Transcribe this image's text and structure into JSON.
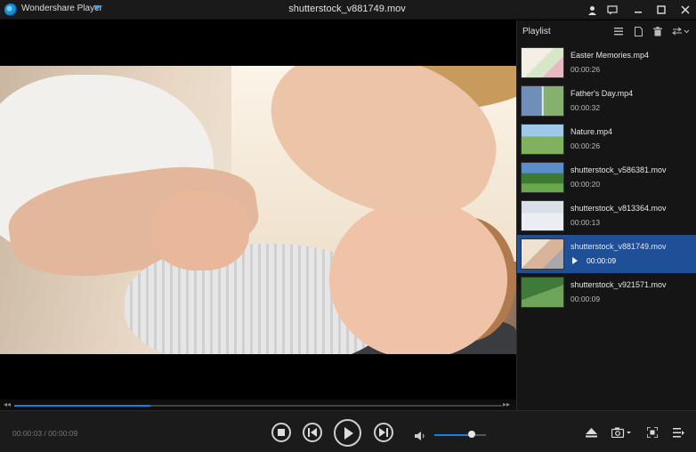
{
  "titlebar": {
    "app_name": "Wondershare Player",
    "file_title": "shutterstock_v881749.mov",
    "icons": [
      "user-icon",
      "feedback-icon",
      "minimize-icon",
      "maximize-icon",
      "close-icon"
    ]
  },
  "video": {
    "progress_fraction": 0.28,
    "seek_back_glyph": "◂◂",
    "seek_fwd_glyph": "▸▸"
  },
  "playlist": {
    "title": "Playlist",
    "tools": [
      "list-view-icon",
      "file-icon",
      "trash-icon",
      "loop-mode-icon"
    ],
    "items": [
      {
        "name": "Easter Memories.mp4",
        "duration": "00:00:26",
        "active": false
      },
      {
        "name": "Father's Day.mp4",
        "duration": "00:00:32",
        "active": false
      },
      {
        "name": "Nature.mp4",
        "duration": "00:00:26",
        "active": false
      },
      {
        "name": "shutterstock_v586381.mov",
        "duration": "00:00:20",
        "active": false
      },
      {
        "name": "shutterstock_v813364.mov",
        "duration": "00:00:13",
        "active": false
      },
      {
        "name": "shutterstock_v881749.mov",
        "duration": "00:00:09",
        "active": true
      },
      {
        "name": "shutterstock_v921571.mov",
        "duration": "00:00:09",
        "active": false
      }
    ]
  },
  "controls": {
    "time": "00:00:03 / 00:00:09",
    "volume_fraction": 0.72
  },
  "colors": {
    "accent": "#1f7fd8",
    "active_row": "#1f4f96"
  }
}
